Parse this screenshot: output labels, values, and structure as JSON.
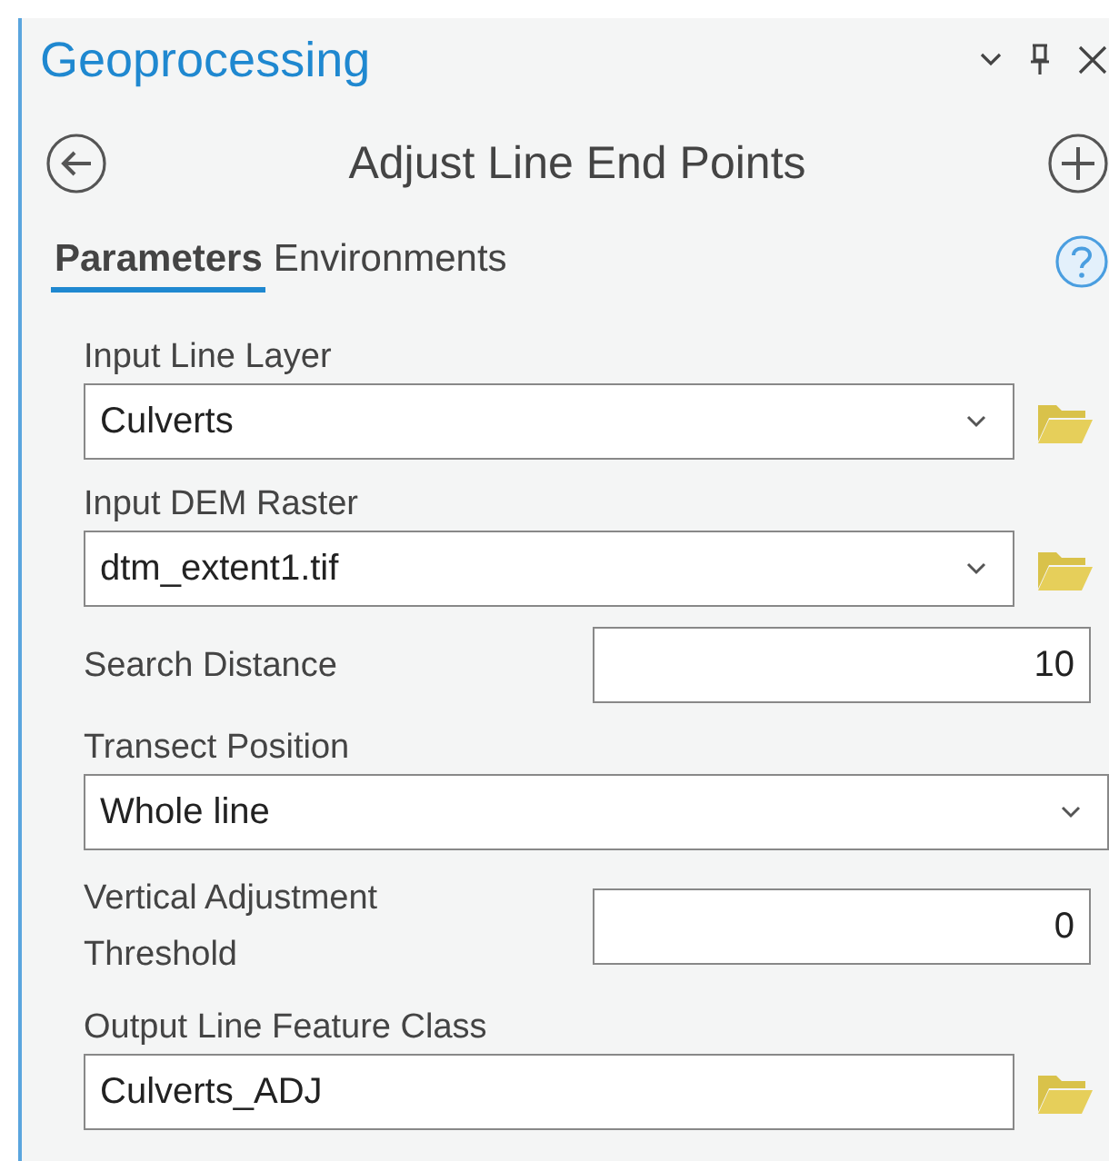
{
  "pane": {
    "title": "Geoprocessing"
  },
  "tool": {
    "title": "Adjust Line End Points"
  },
  "tabs": [
    {
      "label": "Parameters",
      "selected": true
    },
    {
      "label": "Environments",
      "selected": false
    }
  ],
  "fields": [
    {
      "kind": "dropdown",
      "label": "Input Line Layer",
      "value": "Culverts",
      "browse": true
    },
    {
      "kind": "dropdown",
      "label": "Input DEM Raster",
      "value": "dtm_extent1.tif",
      "browse": true
    },
    {
      "kind": "number",
      "label": "Search Distance",
      "value": "10"
    },
    {
      "kind": "dropdown",
      "label": "Transect Position",
      "value": "Whole line",
      "browse": false
    },
    {
      "kind": "number",
      "label": "Vertical Adjustment Threshold",
      "value": "0"
    },
    {
      "kind": "text",
      "label": "Output Line Feature Class",
      "value": "Culverts_ADJ",
      "browse": true
    }
  ]
}
